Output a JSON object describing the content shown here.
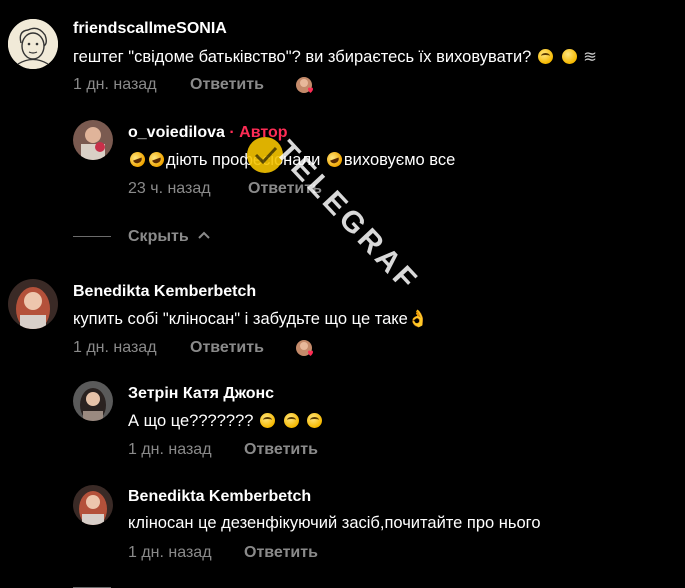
{
  "comments": [
    {
      "username": "friendscallmeSONIA",
      "text": "гештег \"свідоме батьківство\"? ви збираєтесь їх виховувати?",
      "emoji_tail": "≋",
      "time": "1 дн. назад",
      "reply_label": "Ответить"
    },
    {
      "username": "o_voiedilova",
      "author_badge": "· Автор",
      "text_part1": "діють професіонали",
      "text_part2": "виховуємо все",
      "time": "23 ч. назад",
      "reply_label": "Ответить"
    },
    {
      "username": "Benedikta Kemberbetch",
      "text": "купить собі \"кліносан\" і забудьте що це таке",
      "time": "1 дн. назад",
      "reply_label": "Ответить"
    },
    {
      "username": "Зетрін Катя Джонс",
      "text": "А що це???????",
      "time": "1 дн. назад",
      "reply_label": "Ответить"
    },
    {
      "username": "Benedikta Kemberbetch",
      "text": "кліносан це дезенфікуючий засіб,почитайте про нього",
      "time": "1 дн. назад",
      "reply_label": "Ответить"
    }
  ],
  "collapse": {
    "label": "Скрыть"
  },
  "watermark": {
    "text": "TELEGRAF"
  },
  "colors": {
    "background": "#000000",
    "author": "#fe2c55",
    "meta": "#8a8a8a"
  },
  "icons": {
    "collapse": "chevron-up-icon",
    "liked_by_author": "author-liked-icon"
  }
}
